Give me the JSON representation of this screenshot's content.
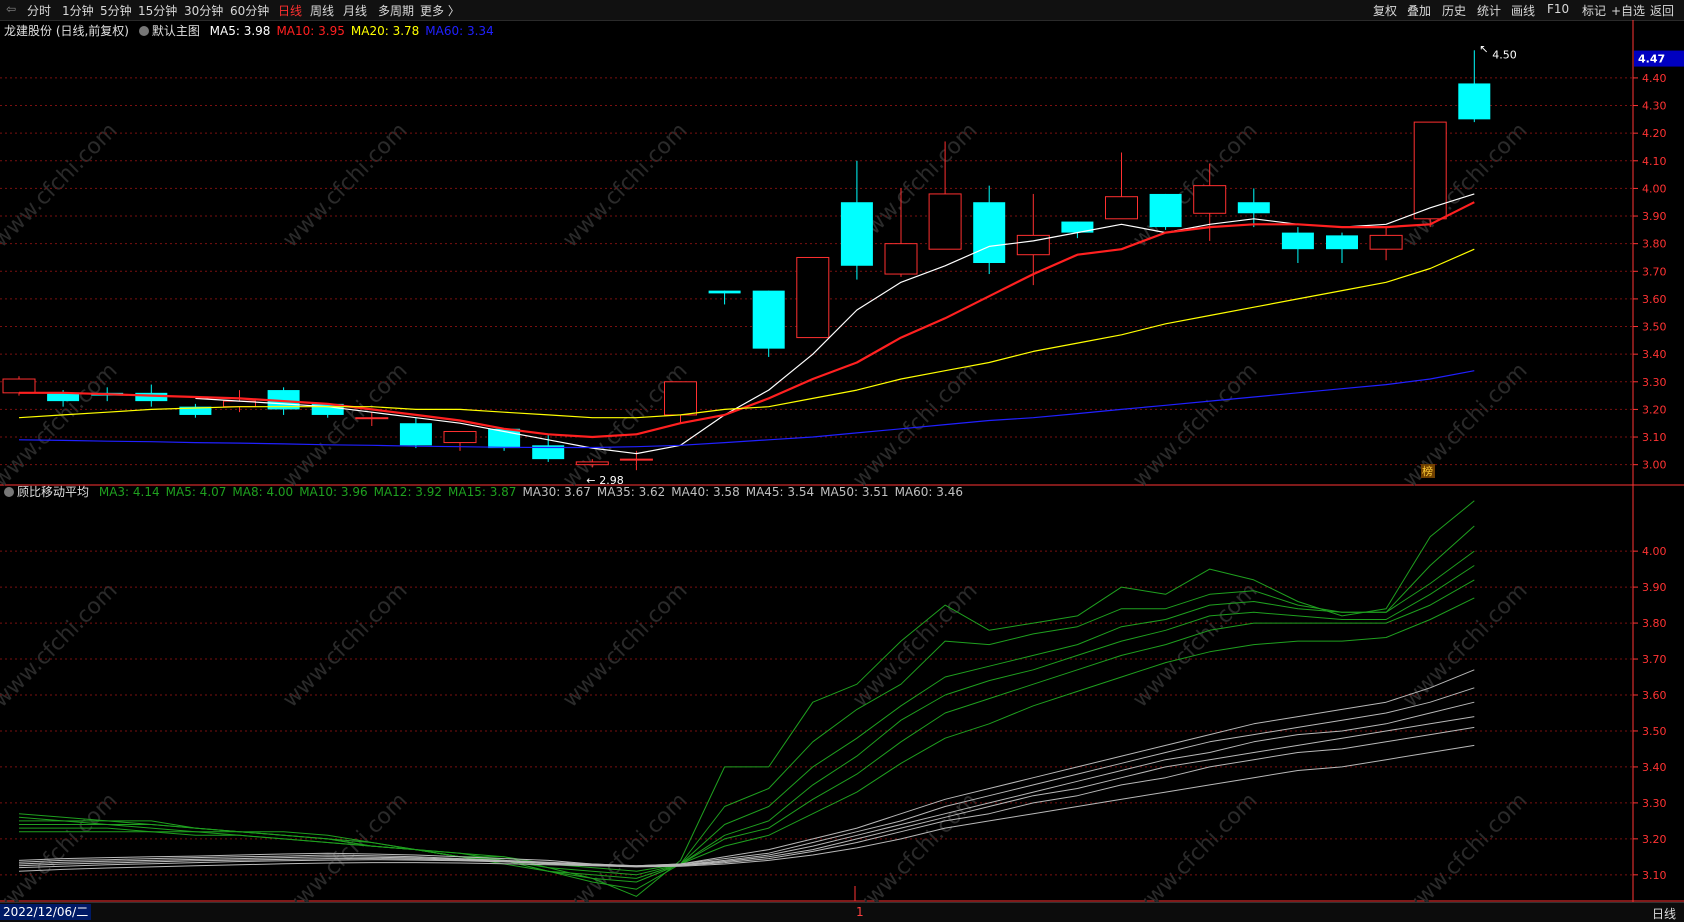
{
  "toolbar": {
    "periods": [
      "分时",
      "1分钟",
      "5分钟",
      "15分钟",
      "30分钟",
      "60分钟",
      "日线",
      "周线",
      "月线",
      "多周期",
      "更多 〉"
    ],
    "active_period": "日线",
    "tools": [
      "复权",
      "叠加",
      "历史",
      "统计",
      "画线",
      "F10",
      "标记",
      "+自选",
      "返回"
    ]
  },
  "main_legend": {
    "stock": "龙建股份 (日线,前复权)",
    "template": "默认主图",
    "items": [
      {
        "label": "MA5: 3.98",
        "color": "#ffffff"
      },
      {
        "label": "MA10: 3.95",
        "color": "#ff2020"
      },
      {
        "label": "MA20: 3.78",
        "color": "#ffff00"
      },
      {
        "label": "MA60: 3.34",
        "color": "#2020ff"
      }
    ]
  },
  "sub_legend": {
    "title": "顾比移动平均",
    "items": [
      {
        "label": "MA3: 4.14",
        "color": "#1fa01f"
      },
      {
        "label": "MA5: 4.07",
        "color": "#1fa01f"
      },
      {
        "label": "MA8: 4.00",
        "color": "#1fa01f"
      },
      {
        "label": "MA10: 3.96",
        "color": "#1fa01f"
      },
      {
        "label": "MA12: 3.92",
        "color": "#1fa01f"
      },
      {
        "label": "MA15: 3.87",
        "color": "#1fa01f"
      },
      {
        "label": "MA30: 3.67",
        "color": "#c0c0c0"
      },
      {
        "label": "MA35: 3.62",
        "color": "#c0c0c0"
      },
      {
        "label": "MA40: 3.58",
        "color": "#c0c0c0"
      },
      {
        "label": "MA45: 3.54",
        "color": "#c0c0c0"
      },
      {
        "label": "MA50: 3.51",
        "color": "#c0c0c0"
      },
      {
        "label": "MA60: 3.46",
        "color": "#c0c0c0"
      }
    ]
  },
  "bottom": {
    "date": "2022/12/06/二",
    "period": "日线",
    "marker": "1"
  },
  "colors": {
    "up": "#ff3030",
    "down": "#00ffff",
    "grid": "#7a1010",
    "axis": "#ff3333",
    "short_group": "#1fa01f",
    "long_group": "#b8b8b8"
  },
  "watermark": "www.cfchi.com",
  "chart_data": [
    {
      "type": "candlestick",
      "name": "main",
      "ylim": [
        2.93,
        4.53
      ],
      "yticks": [
        "3.00",
        "3.10",
        "3.20",
        "3.30",
        "3.40",
        "3.50",
        "3.60",
        "3.70",
        "3.80",
        "3.90",
        "4.00",
        "4.10",
        "4.20",
        "4.30",
        "4.40"
      ],
      "current_price": "4.47",
      "high_label": "4.50",
      "low_label": "2.98",
      "annotation": "榜",
      "candles": [
        {
          "o": 3.26,
          "h": 3.32,
          "l": 3.25,
          "c": 3.31
        },
        {
          "o": 3.26,
          "h": 3.27,
          "l": 3.21,
          "c": 3.23
        },
        {
          "o": 3.26,
          "h": 3.28,
          "l": 3.23,
          "c": 3.25
        },
        {
          "o": 3.26,
          "h": 3.29,
          "l": 3.21,
          "c": 3.23
        },
        {
          "o": 3.21,
          "h": 3.22,
          "l": 3.17,
          "c": 3.18
        },
        {
          "o": 3.21,
          "h": 3.27,
          "l": 3.19,
          "c": 3.23
        },
        {
          "o": 3.27,
          "h": 3.28,
          "l": 3.18,
          "c": 3.2
        },
        {
          "o": 3.22,
          "h": 3.22,
          "l": 3.17,
          "c": 3.18
        },
        {
          "o": 3.17,
          "h": 3.19,
          "l": 3.14,
          "c": 3.17
        },
        {
          "o": 3.15,
          "h": 3.17,
          "l": 3.06,
          "c": 3.07
        },
        {
          "o": 3.08,
          "h": 3.12,
          "l": 3.05,
          "c": 3.12
        },
        {
          "o": 3.13,
          "h": 3.13,
          "l": 3.05,
          "c": 3.06
        },
        {
          "o": 3.07,
          "h": 3.11,
          "l": 3.01,
          "c": 3.02
        },
        {
          "o": 3.0,
          "h": 3.02,
          "l": 2.99,
          "c": 3.01
        },
        {
          "o": 3.02,
          "h": 3.05,
          "l": 2.98,
          "c": 3.02
        },
        {
          "o": 3.18,
          "h": 3.3,
          "l": 3.15,
          "c": 3.3
        },
        {
          "o": 3.63,
          "h": 3.63,
          "l": 3.58,
          "c": 3.62
        },
        {
          "o": 3.63,
          "h": 3.63,
          "l": 3.39,
          "c": 3.42
        },
        {
          "o": 3.46,
          "h": 3.75,
          "l": 3.46,
          "c": 3.75
        },
        {
          "o": 3.95,
          "h": 4.1,
          "l": 3.67,
          "c": 3.72
        },
        {
          "o": 3.69,
          "h": 4.0,
          "l": 3.68,
          "c": 3.8
        },
        {
          "o": 3.78,
          "h": 4.17,
          "l": 3.78,
          "c": 3.98
        },
        {
          "o": 3.95,
          "h": 4.01,
          "l": 3.69,
          "c": 3.73
        },
        {
          "o": 3.76,
          "h": 3.98,
          "l": 3.65,
          "c": 3.83
        },
        {
          "o": 3.88,
          "h": 3.88,
          "l": 3.82,
          "c": 3.84
        },
        {
          "o": 3.89,
          "h": 4.13,
          "l": 3.89,
          "c": 3.97
        },
        {
          "o": 3.98,
          "h": 3.98,
          "l": 3.85,
          "c": 3.86
        },
        {
          "o": 3.91,
          "h": 4.09,
          "l": 3.81,
          "c": 4.01
        },
        {
          "o": 3.95,
          "h": 4.0,
          "l": 3.86,
          "c": 3.91
        },
        {
          "o": 3.84,
          "h": 3.86,
          "l": 3.73,
          "c": 3.78
        },
        {
          "o": 3.83,
          "h": 3.84,
          "l": 3.73,
          "c": 3.78
        },
        {
          "o": 3.78,
          "h": 3.86,
          "l": 3.74,
          "c": 3.83
        },
        {
          "o": 3.89,
          "h": 4.24,
          "l": 3.86,
          "c": 4.24
        },
        {
          "o": 4.38,
          "h": 4.5,
          "l": 4.24,
          "c": 4.25
        }
      ],
      "series": [
        {
          "name": "MA5",
          "color": "#ffffff",
          "width": 1.2,
          "values": [
            null,
            null,
            null,
            null,
            3.24,
            3.23,
            3.22,
            3.21,
            3.19,
            3.17,
            3.15,
            3.12,
            3.09,
            3.06,
            3.04,
            3.07,
            3.18,
            3.27,
            3.4,
            3.56,
            3.66,
            3.72,
            3.79,
            3.81,
            3.84,
            3.87,
            3.84,
            3.87,
            3.89,
            3.87,
            3.86,
            3.87,
            3.93,
            3.98
          ]
        },
        {
          "name": "MA10",
          "color": "#ff2020",
          "width": 2.2,
          "values": [
            3.26,
            3.26,
            3.255,
            3.25,
            3.245,
            3.24,
            3.23,
            3.22,
            3.2,
            3.18,
            3.16,
            3.13,
            3.11,
            3.1,
            3.11,
            3.15,
            3.18,
            3.24,
            3.31,
            3.37,
            3.46,
            3.53,
            3.61,
            3.69,
            3.76,
            3.78,
            3.84,
            3.86,
            3.87,
            3.87,
            3.86,
            3.86,
            3.87,
            3.95
          ]
        },
        {
          "name": "MA20",
          "color": "#ffff00",
          "width": 1.2,
          "values": [
            3.17,
            3.18,
            3.19,
            3.2,
            3.205,
            3.21,
            3.21,
            3.21,
            3.21,
            3.2,
            3.2,
            3.19,
            3.18,
            3.17,
            3.17,
            3.18,
            3.2,
            3.21,
            3.24,
            3.27,
            3.31,
            3.34,
            3.37,
            3.41,
            3.44,
            3.47,
            3.51,
            3.54,
            3.57,
            3.6,
            3.63,
            3.66,
            3.71,
            3.78
          ]
        },
        {
          "name": "MA60",
          "color": "#2020ff",
          "width": 1.2,
          "values": [
            3.09,
            3.088,
            3.085,
            3.083,
            3.08,
            3.078,
            3.075,
            3.072,
            3.07,
            3.067,
            3.065,
            3.063,
            3.062,
            3.062,
            3.065,
            3.07,
            3.08,
            3.09,
            3.1,
            3.115,
            3.13,
            3.145,
            3.16,
            3.17,
            3.185,
            3.2,
            3.215,
            3.23,
            3.245,
            3.26,
            3.275,
            3.29,
            3.31,
            3.34
          ]
        }
      ]
    },
    {
      "type": "line",
      "name": "sub",
      "ylim": [
        3.03,
        4.17
      ],
      "yticks": [
        "3.10",
        "3.20",
        "3.30",
        "3.40",
        "3.50",
        "3.60",
        "3.70",
        "3.80",
        "3.90",
        "4.00"
      ],
      "series": [
        {
          "name": "MA3",
          "group": "short",
          "values": [
            3.27,
            3.26,
            3.25,
            3.25,
            3.23,
            3.22,
            3.22,
            3.21,
            3.19,
            3.17,
            3.15,
            3.15,
            3.12,
            3.09,
            3.04,
            3.14,
            3.4,
            3.4,
            3.58,
            3.63,
            3.75,
            3.85,
            3.78,
            3.8,
            3.82,
            3.9,
            3.88,
            3.95,
            3.92,
            3.86,
            3.82,
            3.84,
            4.04,
            4.14
          ]
        },
        {
          "name": "MA5",
          "group": "short",
          "values": [
            3.26,
            3.25,
            3.25,
            3.24,
            3.23,
            3.22,
            3.21,
            3.2,
            3.19,
            3.17,
            3.15,
            3.14,
            3.11,
            3.08,
            3.06,
            3.13,
            3.29,
            3.34,
            3.47,
            3.56,
            3.63,
            3.75,
            3.74,
            3.77,
            3.79,
            3.84,
            3.84,
            3.88,
            3.89,
            3.85,
            3.83,
            3.83,
            3.96,
            4.07
          ]
        },
        {
          "name": "MA8",
          "group": "short",
          "values": [
            3.25,
            3.25,
            3.24,
            3.24,
            3.23,
            3.22,
            3.21,
            3.2,
            3.18,
            3.17,
            3.15,
            3.13,
            3.11,
            3.09,
            3.08,
            3.13,
            3.24,
            3.29,
            3.4,
            3.48,
            3.57,
            3.65,
            3.68,
            3.71,
            3.74,
            3.79,
            3.81,
            3.85,
            3.86,
            3.84,
            3.83,
            3.83,
            3.91,
            4.0
          ]
        },
        {
          "name": "MA10",
          "group": "short",
          "values": [
            3.24,
            3.24,
            3.24,
            3.23,
            3.22,
            3.22,
            3.21,
            3.2,
            3.18,
            3.17,
            3.15,
            3.14,
            3.11,
            3.1,
            3.09,
            3.13,
            3.21,
            3.25,
            3.35,
            3.43,
            3.53,
            3.6,
            3.64,
            3.67,
            3.71,
            3.75,
            3.78,
            3.82,
            3.83,
            3.82,
            3.81,
            3.81,
            3.88,
            3.96
          ]
        },
        {
          "name": "MA12",
          "group": "short",
          "values": [
            3.23,
            3.23,
            3.23,
            3.22,
            3.22,
            3.21,
            3.2,
            3.19,
            3.18,
            3.17,
            3.16,
            3.14,
            3.12,
            3.11,
            3.1,
            3.13,
            3.2,
            3.23,
            3.31,
            3.38,
            3.47,
            3.55,
            3.59,
            3.63,
            3.67,
            3.71,
            3.74,
            3.78,
            3.8,
            3.8,
            3.8,
            3.8,
            3.85,
            3.92
          ]
        },
        {
          "name": "MA15",
          "group": "short",
          "values": [
            3.22,
            3.22,
            3.22,
            3.22,
            3.21,
            3.21,
            3.2,
            3.19,
            3.18,
            3.17,
            3.16,
            3.15,
            3.13,
            3.12,
            3.11,
            3.13,
            3.18,
            3.21,
            3.27,
            3.33,
            3.41,
            3.48,
            3.52,
            3.57,
            3.61,
            3.65,
            3.69,
            3.72,
            3.74,
            3.75,
            3.75,
            3.76,
            3.81,
            3.87
          ]
        },
        {
          "name": "MA30",
          "group": "long",
          "values": [
            3.14,
            3.145,
            3.148,
            3.15,
            3.152,
            3.155,
            3.158,
            3.16,
            3.158,
            3.155,
            3.15,
            3.145,
            3.14,
            3.13,
            3.125,
            3.13,
            3.15,
            3.17,
            3.2,
            3.23,
            3.27,
            3.31,
            3.34,
            3.37,
            3.4,
            3.43,
            3.46,
            3.49,
            3.52,
            3.54,
            3.56,
            3.58,
            3.62,
            3.67
          ]
        },
        {
          "name": "MA35",
          "group": "long",
          "values": [
            3.135,
            3.14,
            3.142,
            3.145,
            3.148,
            3.15,
            3.152,
            3.155,
            3.153,
            3.15,
            3.145,
            3.14,
            3.135,
            3.13,
            3.125,
            3.13,
            3.145,
            3.16,
            3.19,
            3.22,
            3.25,
            3.29,
            3.32,
            3.35,
            3.38,
            3.41,
            3.44,
            3.47,
            3.49,
            3.51,
            3.53,
            3.55,
            3.58,
            3.62
          ]
        },
        {
          "name": "MA40",
          "group": "long",
          "values": [
            3.13,
            3.135,
            3.138,
            3.14,
            3.143,
            3.145,
            3.148,
            3.15,
            3.149,
            3.147,
            3.143,
            3.138,
            3.133,
            3.128,
            3.124,
            3.128,
            3.14,
            3.155,
            3.18,
            3.21,
            3.24,
            3.27,
            3.3,
            3.33,
            3.36,
            3.39,
            3.42,
            3.44,
            3.47,
            3.49,
            3.5,
            3.52,
            3.55,
            3.58
          ]
        },
        {
          "name": "MA45",
          "group": "long",
          "values": [
            3.125,
            3.13,
            3.133,
            3.136,
            3.139,
            3.141,
            3.143,
            3.145,
            3.145,
            3.144,
            3.141,
            3.137,
            3.132,
            3.127,
            3.123,
            3.127,
            3.137,
            3.15,
            3.17,
            3.2,
            3.23,
            3.26,
            3.29,
            3.32,
            3.34,
            3.37,
            3.4,
            3.42,
            3.44,
            3.46,
            3.48,
            3.5,
            3.52,
            3.54
          ]
        },
        {
          "name": "MA50",
          "group": "long",
          "values": [
            3.12,
            3.124,
            3.128,
            3.131,
            3.134,
            3.137,
            3.139,
            3.141,
            3.142,
            3.141,
            3.139,
            3.136,
            3.131,
            3.127,
            3.123,
            3.126,
            3.134,
            3.145,
            3.165,
            3.19,
            3.22,
            3.25,
            3.27,
            3.3,
            3.32,
            3.35,
            3.37,
            3.4,
            3.42,
            3.44,
            3.45,
            3.47,
            3.49,
            3.51
          ]
        },
        {
          "name": "MA60",
          "group": "long",
          "values": [
            3.11,
            3.115,
            3.119,
            3.122,
            3.125,
            3.128,
            3.131,
            3.133,
            3.134,
            3.134,
            3.133,
            3.131,
            3.128,
            3.125,
            3.122,
            3.124,
            3.13,
            3.14,
            3.155,
            3.175,
            3.2,
            3.23,
            3.25,
            3.27,
            3.29,
            3.31,
            3.33,
            3.35,
            3.37,
            3.39,
            3.4,
            3.42,
            3.44,
            3.46
          ]
        }
      ]
    }
  ]
}
